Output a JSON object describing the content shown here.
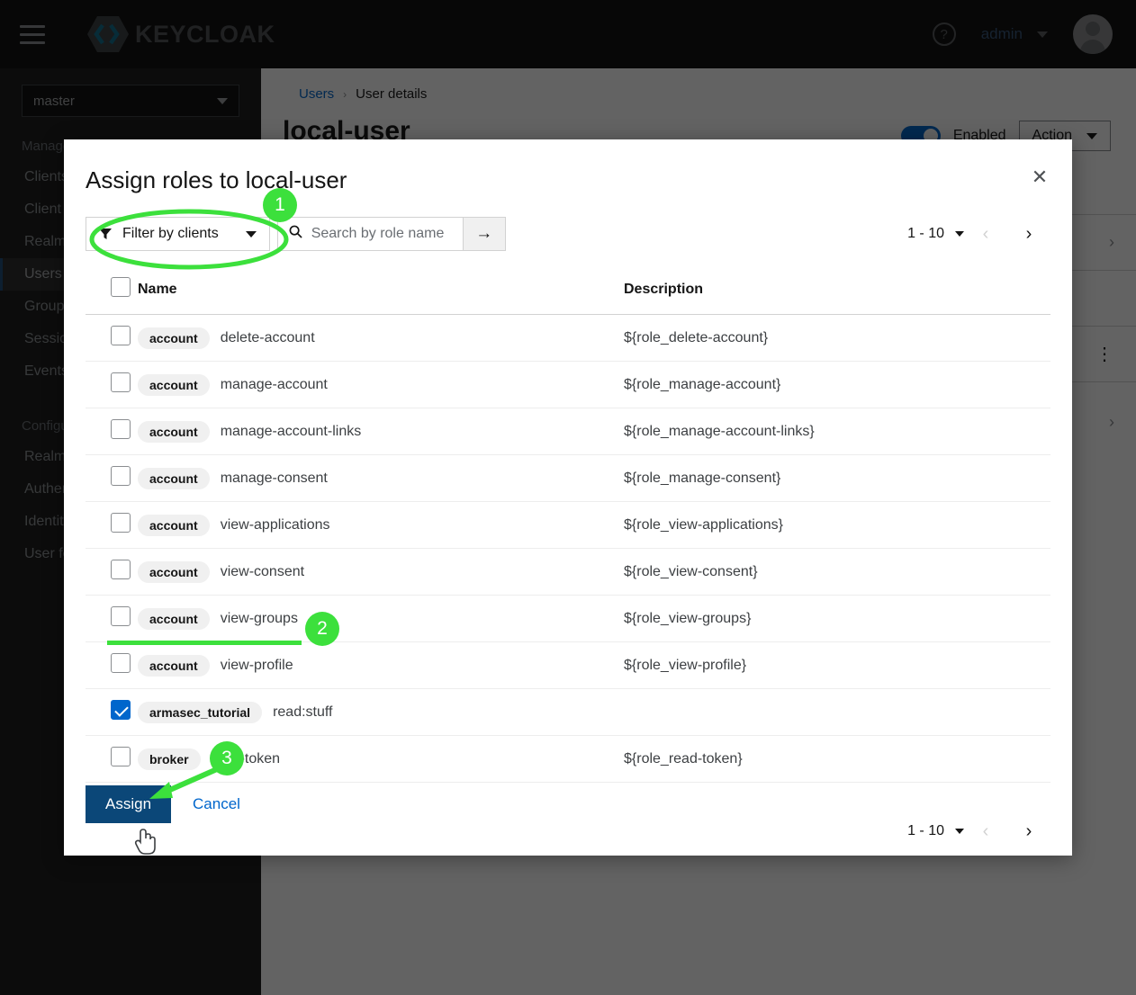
{
  "masthead": {
    "menu_icon": "hamburger-icon",
    "brand": "KEYCLOAK",
    "help_icon": "question-circle-icon",
    "user": "admin",
    "avatar_icon": "user-avatar-icon"
  },
  "sidebar": {
    "realm_selected": "master",
    "sections": [
      {
        "title": "Manage",
        "items": [
          {
            "label": "Clients",
            "active": false
          },
          {
            "label": "Client scopes",
            "active": false
          },
          {
            "label": "Realm roles",
            "active": false
          },
          {
            "label": "Users",
            "active": true
          },
          {
            "label": "Groups",
            "active": false
          },
          {
            "label": "Sessions",
            "active": false
          },
          {
            "label": "Events",
            "active": false
          }
        ]
      },
      {
        "title": "Configure",
        "items": [
          {
            "label": "Realm settings",
            "active": false
          },
          {
            "label": "Authentication",
            "active": false
          },
          {
            "label": "Identity providers",
            "active": false
          },
          {
            "label": "User federation",
            "active": false
          }
        ]
      }
    ]
  },
  "page": {
    "breadcrumb": {
      "root": "Users",
      "separator": "›",
      "current": "User details"
    },
    "title": "local-user",
    "enabled_label": "Enabled",
    "action_label": "Action"
  },
  "modal": {
    "title": "Assign roles to local-user",
    "close_label": "✕",
    "filter": {
      "label": "Filter by clients",
      "icon": "filter-funnel-icon"
    },
    "search": {
      "placeholder": "Search by role name",
      "value": "",
      "icon": "search-icon",
      "submit_icon": "arrow-right-icon"
    },
    "pagination_top": {
      "range": "1 - 10",
      "prev_icon": "chevron-left-icon",
      "next_icon": "chevron-right-icon"
    },
    "pagination_bottom": {
      "range": "1 - 10",
      "prev_icon": "chevron-left-icon",
      "next_icon": "chevron-right-icon"
    },
    "table": {
      "columns": [
        "Name",
        "Description"
      ],
      "rows": [
        {
          "checked": false,
          "client": "account",
          "role": "delete-account",
          "description": "${role_delete-account}"
        },
        {
          "checked": false,
          "client": "account",
          "role": "manage-account",
          "description": "${role_manage-account}"
        },
        {
          "checked": false,
          "client": "account",
          "role": "manage-account-links",
          "description": "${role_manage-account-links}"
        },
        {
          "checked": false,
          "client": "account",
          "role": "manage-consent",
          "description": "${role_manage-consent}"
        },
        {
          "checked": false,
          "client": "account",
          "role": "view-applications",
          "description": "${role_view-applications}"
        },
        {
          "checked": false,
          "client": "account",
          "role": "view-consent",
          "description": "${role_view-consent}"
        },
        {
          "checked": false,
          "client": "account",
          "role": "view-groups",
          "description": "${role_view-groups}"
        },
        {
          "checked": false,
          "client": "account",
          "role": "view-profile",
          "description": "${role_view-profile}"
        },
        {
          "checked": true,
          "client": "armasec_tutorial",
          "role": "read:stuff",
          "description": ""
        },
        {
          "checked": false,
          "client": "broker",
          "role": "read-token",
          "description": "${role_read-token}"
        }
      ]
    },
    "assign_label": "Assign",
    "cancel_label": "Cancel"
  },
  "annotations": {
    "accent_color": "#3ce03c",
    "steps": [
      {
        "number": "1",
        "target": "filter-by-clients-dropdown",
        "shape": "ellipse"
      },
      {
        "number": "2",
        "target": "armasec-tutorial-row",
        "shape": "underline"
      },
      {
        "number": "3",
        "target": "assign-button",
        "shape": "arrow"
      }
    ]
  }
}
